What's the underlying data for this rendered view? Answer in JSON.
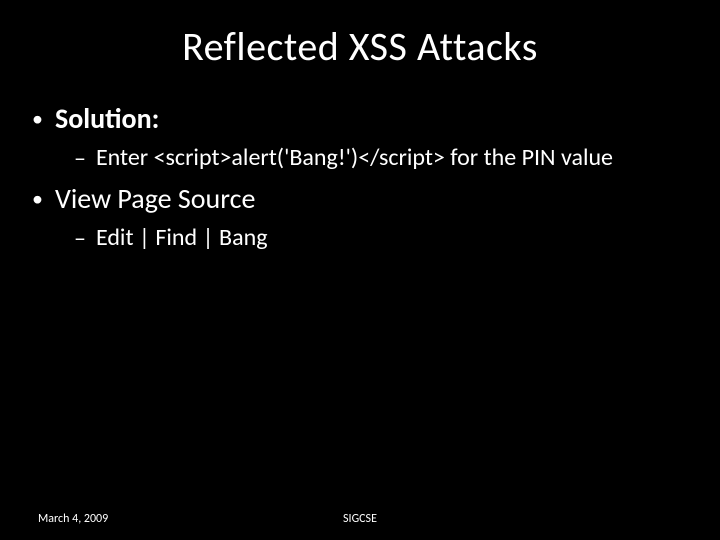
{
  "title": "Reflected XSS Attacks",
  "bullets": {
    "b1": "Solution:",
    "b1a": "Enter <script>alert('Bang!')</script> for the PIN value",
    "b2": "View Page Source",
    "b2a": "Edit | Find | Bang"
  },
  "footer": {
    "date": "March 4, 2009",
    "center": "SIGCSE"
  }
}
